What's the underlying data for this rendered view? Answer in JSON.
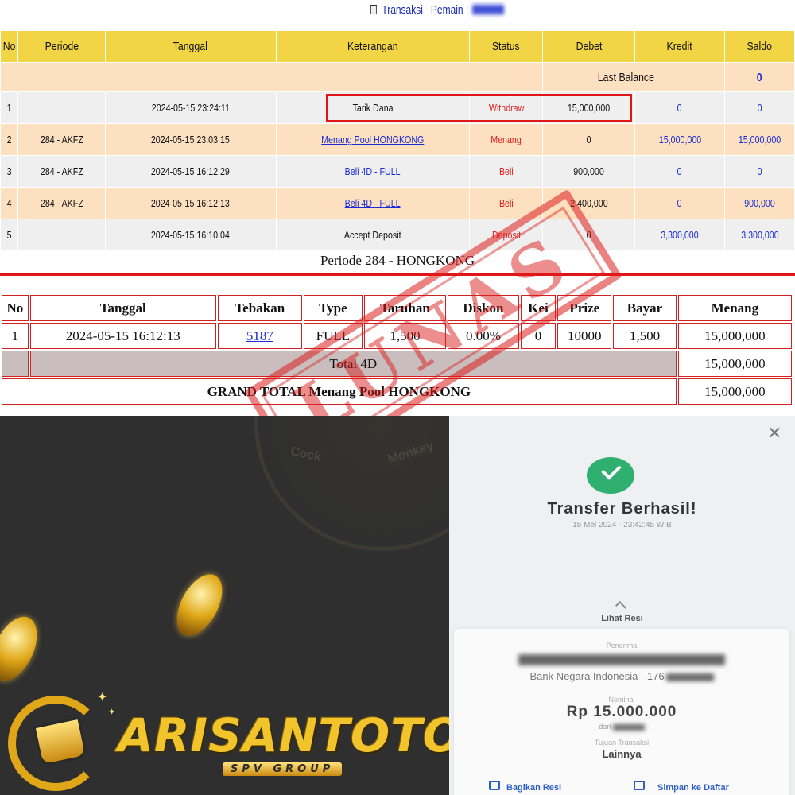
{
  "header": {
    "title": "Transaksi",
    "pemain_label": "Pemain :"
  },
  "trx_table": {
    "columns": [
      "No",
      "Periode",
      "Tanggal",
      "Keterangan",
      "Status",
      "Debet",
      "Kredit",
      "Saldo"
    ],
    "last_balance_label": "Last Balance",
    "last_balance_value": "0",
    "rows": [
      {
        "no": "1",
        "periode": "",
        "tanggal": "2024-05-15 23:24:11",
        "keterangan": "Tarik Dana",
        "status": "Withdraw",
        "debet": "15,000,000",
        "kredit": "0",
        "saldo": "0"
      },
      {
        "no": "2",
        "periode": "284 - AKFZ",
        "tanggal": "2024-05-15 23:03:15",
        "keterangan": "Menang Pool HONGKONG",
        "status": "Menang",
        "debet": "0",
        "kredit": "15,000,000",
        "saldo": "15,000,000"
      },
      {
        "no": "3",
        "periode": "284 - AKFZ",
        "tanggal": "2024-05-15 16:12:29",
        "keterangan": "Beli 4D - FULL",
        "status": "Beli",
        "debet": "900,000",
        "kredit": "0",
        "saldo": "0"
      },
      {
        "no": "4",
        "periode": "284 - AKFZ",
        "tanggal": "2024-05-15 16:12:13",
        "keterangan": "Beli 4D - FULL",
        "status": "Beli",
        "debet": "2,400,000",
        "kredit": "0",
        "saldo": "900,000"
      },
      {
        "no": "5",
        "periode": "",
        "tanggal": "2024-05-15 16:10:04",
        "keterangan": "Accept Deposit",
        "status": "Deposit",
        "debet": "0",
        "kredit": "3,300,000",
        "saldo": "3,300,000"
      }
    ]
  },
  "periode_title": "Periode 284 - HONGKONG",
  "detail_table": {
    "columns": [
      "No",
      "Tanggal",
      "Tebakan",
      "Type",
      "Taruhan",
      "Diskon",
      "Kei",
      "Prize",
      "Bayar",
      "Menang"
    ],
    "row": {
      "no": "1",
      "tanggal": "2024-05-15 16:12:13",
      "tebakan": "5187",
      "type": "FULL",
      "taruhan": "1,500",
      "diskon": "0.00%",
      "kei": "0",
      "prize": "10000",
      "bayar": "1,500",
      "menang": "15,000,000"
    },
    "total_label": "Total 4D",
    "total_value": "15,000,000",
    "grand_label": "GRAND TOTAL  Menang Pool HONGKONG",
    "grand_value": "15,000,000"
  },
  "stamp_text": "LUNAS",
  "promo": {
    "wheel_labels": [
      "Cock",
      "Monkey"
    ],
    "brand": "ARISANTOTO",
    "brand_sub": "SPV GROUP"
  },
  "receipt": {
    "title": "Transfer Berhasil!",
    "datetime": "15 Mei 2024 - 23:42:45 WIB",
    "lihat_resi": "Lihat Resi",
    "penerima_label": "Penerima",
    "bank": "Bank Negara Indonesia - 176",
    "nominal_label": "Nominal",
    "nominal": "Rp 15.000.000",
    "dari_label": "dari",
    "tujuan_label": "Tujuan Transaksi",
    "tujuan": "Lainnya",
    "bagikan": "Bagikan Resi",
    "simpan": "Simpan ke Daftar"
  },
  "colors": {
    "header_yellow": "#f2d545",
    "peach_row": "#fce0c0",
    "grey_row": "#efefef",
    "link_blue": "#1a2bd6",
    "status_red": "#e02020",
    "success_green": "#2fb070",
    "brand_gold": "#f2c42c"
  }
}
